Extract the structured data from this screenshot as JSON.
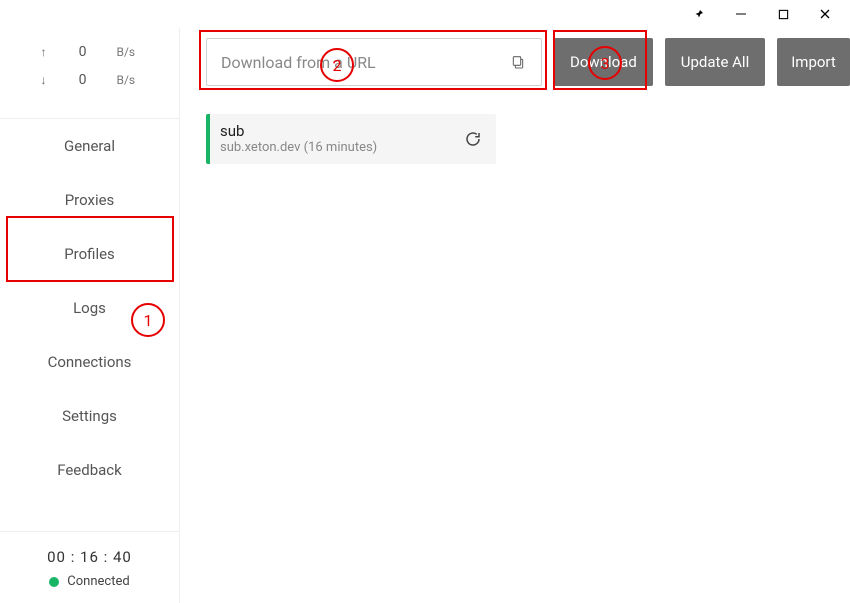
{
  "titlebar": {},
  "speeds": {
    "up_value": "0",
    "up_unit": "B/s",
    "down_value": "0",
    "down_unit": "B/s"
  },
  "nav": {
    "items": [
      {
        "label": "General"
      },
      {
        "label": "Proxies"
      },
      {
        "label": "Profiles"
      },
      {
        "label": "Logs"
      },
      {
        "label": "Connections"
      },
      {
        "label": "Settings"
      },
      {
        "label": "Feedback"
      }
    ]
  },
  "status": {
    "time": "00 : 16 : 40",
    "label": "Connected"
  },
  "toolbar": {
    "url_placeholder": "Download from a URL",
    "download_label": "Download",
    "update_all_label": "Update All",
    "import_label": "Import"
  },
  "profile": {
    "name": "sub",
    "meta": "sub.xeton.dev (16 minutes)"
  },
  "annotations": {
    "a1": "1",
    "a2": "2",
    "a3": "3"
  }
}
